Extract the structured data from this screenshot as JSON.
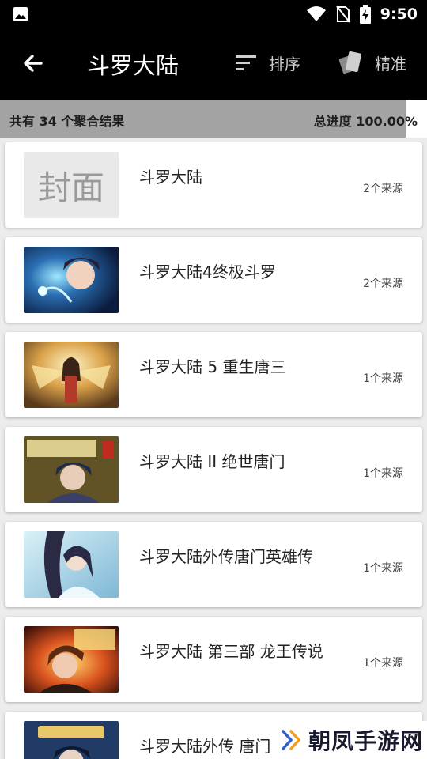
{
  "status_bar": {
    "time": "9:50",
    "icons": [
      "image-icon",
      "wifi-icon",
      "no-sim-icon",
      "battery-charging-icon"
    ]
  },
  "toolbar": {
    "title": "斗罗大陆",
    "sort_label": "排序",
    "precise_label": "精准"
  },
  "progress": {
    "summary": "共有 34 个聚合结果",
    "total_label": "总进度 100.00%",
    "percent": 100,
    "fill_color": "#a3a3a3"
  },
  "results": [
    {
      "title": "斗罗大陆",
      "sources": "2个来源",
      "cover_placeholder": "封面"
    },
    {
      "title": "斗罗大陆4终极斗罗",
      "sources": "2个来源"
    },
    {
      "title": "斗罗大陆 5 重生唐三",
      "sources": "1个来源"
    },
    {
      "title": "斗罗大陆 II 绝世唐门",
      "sources": "1个来源"
    },
    {
      "title": "斗罗大陆外传唐门英雄传",
      "sources": "1个来源"
    },
    {
      "title": "斗罗大陆 第三部 龙王传说",
      "sources": "1个来源"
    },
    {
      "title": "斗罗大陆外传 唐门",
      "sources": ""
    }
  ],
  "watermark": {
    "text": "朝凤手游网"
  }
}
